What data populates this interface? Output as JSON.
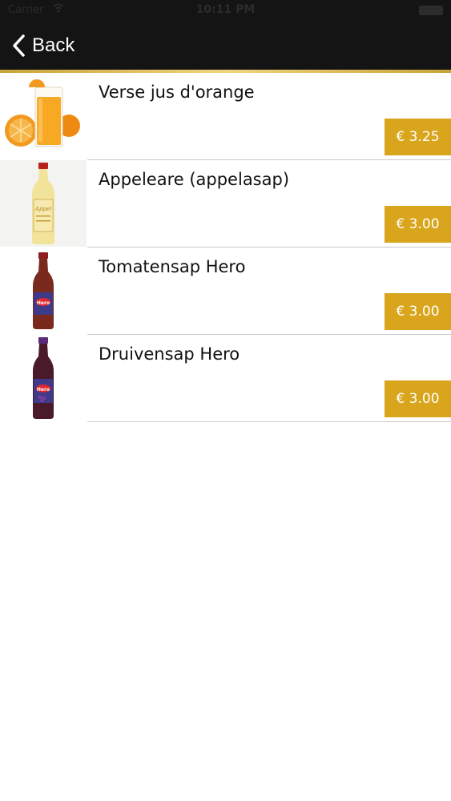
{
  "status_bar": {
    "carrier": "Carrier",
    "time": "10:11 PM"
  },
  "nav": {
    "back_label": "Back"
  },
  "products": [
    {
      "name": "Verse jus d'orange",
      "price": "€ 3.25",
      "image": "orange-juice-image"
    },
    {
      "name": "Appeleare (appelasap)",
      "price": "€ 3.00",
      "image": "apple-juice-bottle-image"
    },
    {
      "name": "Tomatensap Hero",
      "price": "€ 3.00",
      "image": "tomato-juice-bottle-image"
    },
    {
      "name": "Druivensap Hero",
      "price": "€ 3.00",
      "image": "grape-juice-bottle-image"
    }
  ],
  "colors": {
    "nav_background": "#141414",
    "accent_gold": "#d9a51c"
  }
}
